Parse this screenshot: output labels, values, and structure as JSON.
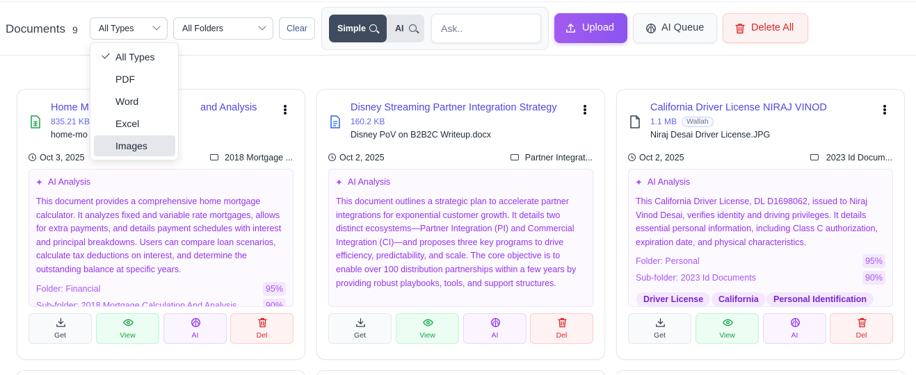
{
  "header": {
    "title": "Documents",
    "count": "9",
    "type_filter": "All Types",
    "folder_filter": "All Folders",
    "clear_label": "Clear",
    "search_modes": {
      "simple": "Simple",
      "ai": "AI"
    },
    "ask_placeholder": "Ask..",
    "upload_label": "Upload",
    "ai_queue_label": "AI Queue",
    "delete_all_label": "Delete All"
  },
  "type_dropdown": {
    "options": [
      "All Types",
      "PDF",
      "Word",
      "Excel",
      "Images"
    ],
    "selected": "All Types",
    "highlighted": "Images"
  },
  "ai_heading": "AI Analysis",
  "actions": {
    "get": "Get",
    "view": "View",
    "ai": "AI",
    "del": "Del"
  },
  "cards": [
    {
      "title": "Home M",
      "title_tail": "and Analysis",
      "size": "835.21 KB",
      "filename": "home-mo",
      "date": "Oct 3, 2025",
      "folder": "2018 Mortgage ...",
      "icon": "spreadsheet-icon",
      "analysis": "This document provides a comprehensive home mortgage calculator. It analyzes fixed and variable rate mortgages, allows for extra payments, and details payment schedules with interest and principal breakdowns. Users can compare loan scenarios, calculate tax deductions on interest, and determine the outstanding balance at specific years.",
      "folder_line": "Folder: Financial",
      "folder_pct": "95%",
      "subfolder_line": "Sub-folder: 2018 Mortgage Calculation And Analysis",
      "subfolder_pct": "90%"
    },
    {
      "title": "Disney Streaming Partner Integration Strategy",
      "size": "160.2 KB",
      "filename": "Disney PoV on B2B2C Writeup.docx",
      "date": "Oct 2, 2025",
      "folder": "Partner Integrat...",
      "icon": "document-icon",
      "analysis": "This document outlines a strategic plan to accelerate partner integrations for exponential customer growth. It details two distinct ecosystems—Partner Integration (PI) and Commercial Integration (CI)—and proposes three key programs to drive efficiency, predictability, and scale. The core objective is to enable over 100 distribution partnerships within a few years by providing robust playbooks, tools, and support structures."
    },
    {
      "title": "California Driver License NIRAJ VINOD",
      "size": "1.1 MB",
      "tag": "Wallah",
      "filename": "Niraj Desai Driver License.JPG",
      "date": "Oct 2, 2025",
      "folder": "2023 Id Docum...",
      "icon": "file-icon",
      "analysis": "This California Driver License, DL D1698062, issued to Niraj Vinod Desai, verifies identity and driving privileges. It details essential personal information, including Class C authorization, expiration date, and physical characteristics.",
      "folder_line": "Folder: Personal",
      "folder_pct": "95%",
      "subfolder_line": "Sub-folder: 2023 Id Documents",
      "subfolder_pct": "90%",
      "chips": [
        "Driver License",
        "California",
        "Personal Identification"
      ]
    }
  ],
  "colors": {
    "accent": "#8b55ef",
    "title_link": "#4f46e5",
    "ai_text": "#9333ea",
    "danger": "#dc2626",
    "success": "#16a34a"
  }
}
